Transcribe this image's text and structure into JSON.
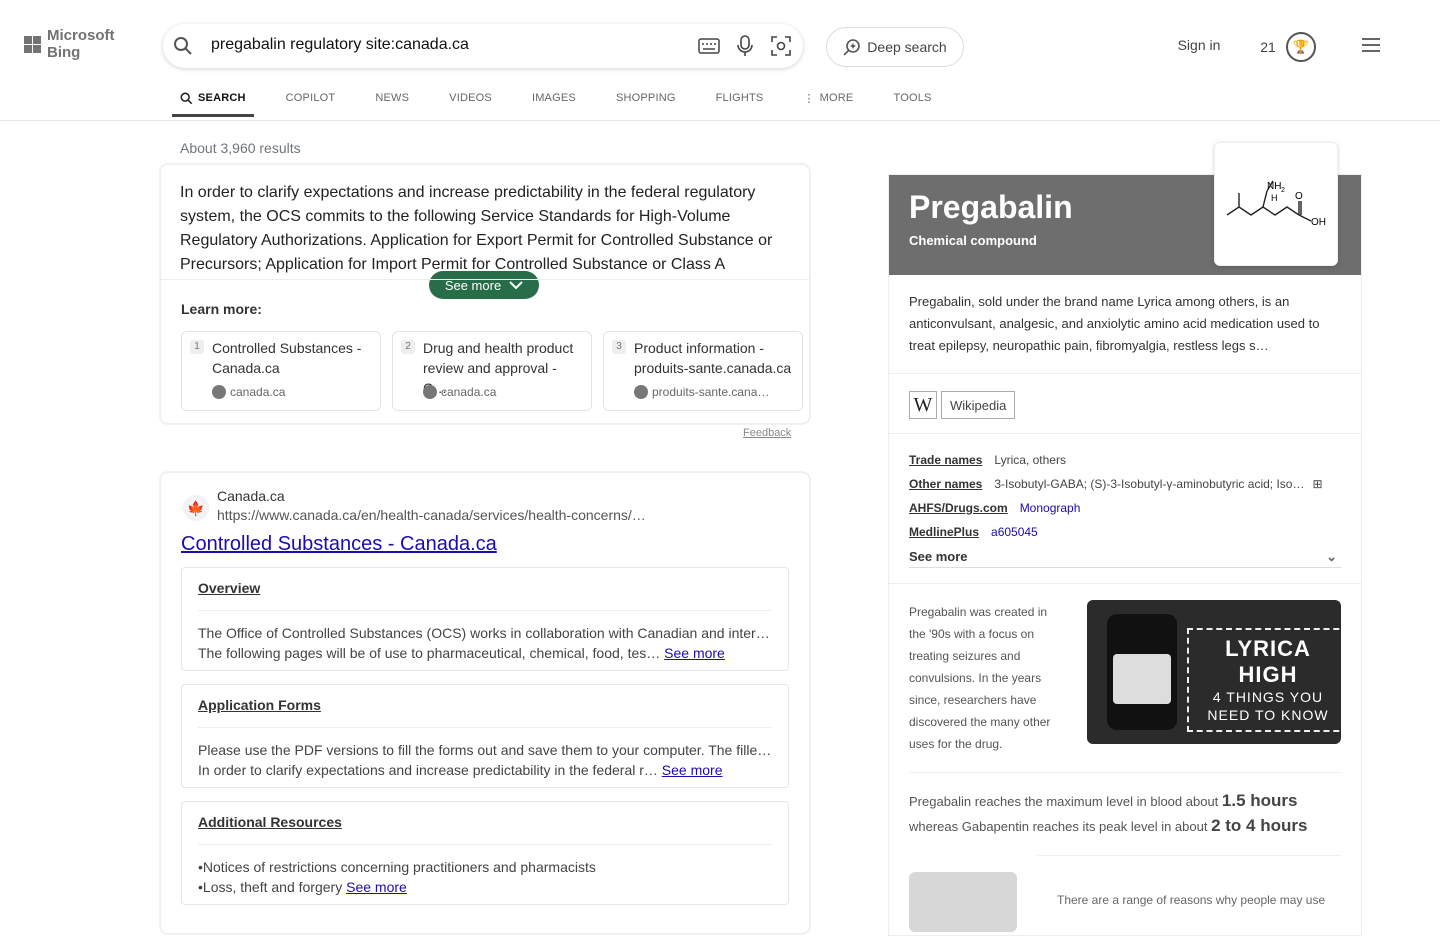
{
  "header": {
    "logo_text": "Microsoft Bing",
    "query": "pregabalin regulatory site:canada.ca",
    "deep_search": "Deep search",
    "sign_in": "Sign in",
    "rewards_count": "21"
  },
  "tabs": [
    {
      "label": "SEARCH",
      "icon": "search-icon"
    },
    {
      "label": "COPILOT"
    },
    {
      "label": "NEWS"
    },
    {
      "label": "VIDEOS"
    },
    {
      "label": "IMAGES"
    },
    {
      "label": "SHOPPING"
    },
    {
      "label": "FLIGHTS"
    },
    {
      "label": "MORE",
      "icon": "more-vertical-icon"
    },
    {
      "label": "TOOLS"
    }
  ],
  "results_count": "About 3,960 results",
  "answer": {
    "text": "In order to clarify expectations and increase predictability in the federal regulatory system, the OCS commits to the following Service Standards for High-Volume Regulatory Authorizations. Application for Export Permit for Controlled Substance or Precursors; Application for Import Permit for Controlled Substance or Class A",
    "see_more": "See more",
    "learn_more_label": "Learn more:",
    "learn_more": [
      {
        "num": "1",
        "title": "Controlled Substances - Canada.ca",
        "domain": "canada.ca"
      },
      {
        "num": "2",
        "title": "Drug and health product review and approval - C…",
        "domain": "canada.ca"
      },
      {
        "num": "3",
        "title": "Product information - produits-sante.canada.ca",
        "domain": "produits-sante.cana…"
      }
    ],
    "feedback": "Feedback"
  },
  "result": {
    "site_name": "Canada.ca",
    "url": "https://www.canada.ca/en/health-canada/services/health-concerns/…",
    "title": "Controlled Substances - Canada.ca",
    "sections": [
      {
        "heading": "Overview",
        "line1": "The Office of Controlled Substances (OCS) works in collaboration with Canadian and intern…",
        "line2": "The following pages will be of use to pharmaceutical, chemical, food, tes…",
        "see_more": "See more"
      },
      {
        "heading": "Application Forms",
        "line1": "Please use the PDF versions to fill the forms out and save them to your computer. The fille…",
        "line2": "In order to clarify expectations and increase predictability in the federal r…",
        "see_more": "See more"
      },
      {
        "heading": "Additional Resources",
        "line1": "•Notices of restrictions concerning practitioners and pharmacists",
        "line2": "•Loss, theft and forgery",
        "see_more": "See more"
      }
    ]
  },
  "knowledge_panel": {
    "title": "Pregabalin",
    "subtitle": "Chemical compound",
    "description": "Pregabalin, sold under the brand name Lyrica among others, is an anticonvulsant, analgesic, and anxiolytic amino acid medication used to treat epilepsy, neuropathic pain, fibromyalgia, restless legs s…",
    "wiki_link": "Wikipedia",
    "facts": [
      {
        "label": "Trade names",
        "value": "Lyrica, others"
      },
      {
        "label": "Other names",
        "value": "3-Isobutyl-GABA; (S)-3-Isobutyl-γ-aminobutyric acid; Iso…"
      },
      {
        "label": "AHFS/Drugs.com",
        "value": "Monograph"
      },
      {
        "label": "MedlinePlus",
        "value": "a605045"
      }
    ],
    "see_more": "See more",
    "fact_lines": [
      "Pregabalin was created in",
      "the '90s with a focus on",
      "treating seizures and",
      "convulsions. In the years",
      "since, researchers have",
      "discovered the many other",
      "uses for the drug."
    ],
    "video": {
      "line1": "LYRICA HIGH",
      "line2": "4 THINGS YOU",
      "line3": "NEED TO KNOW"
    },
    "compare": [
      {
        "text": "Pregabalin reaches the maximum level in blood about",
        "value": "1.5 hours"
      },
      {
        "text": "whereas Gabapentin reaches its peak level in about",
        "value": "2 to 4 hours"
      }
    ],
    "more_text": "There are a range of reasons why people may use"
  }
}
